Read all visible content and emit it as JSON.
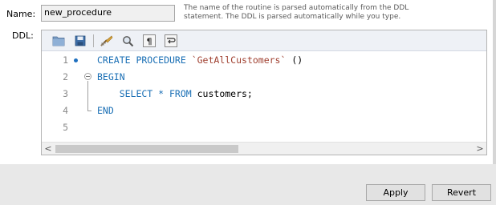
{
  "form": {
    "name_label": "Name:",
    "name_value": "new_procedure",
    "help_line1": "The name of the routine is parsed automatically from the DDL",
    "help_line2": "statement. The DDL is parsed automatically while you type.",
    "ddl_label": "DDL:"
  },
  "toolbar": {
    "buttons": [
      "folder-icon",
      "save-icon",
      "beautify-icon",
      "find-icon",
      "show-invisibles-icon",
      "word-wrap-icon"
    ]
  },
  "editor": {
    "lines": [
      {
        "num": "1",
        "parts": [
          "CREATE PROCEDURE ",
          "`GetAllCustomers`",
          " ()"
        ]
      },
      {
        "num": "2",
        "parts": [
          "BEGIN"
        ]
      },
      {
        "num": "3",
        "parts": [
          "    SELECT * FROM ",
          "customers;"
        ]
      },
      {
        "num": "4",
        "parts": [
          "END"
        ]
      },
      {
        "num": "5",
        "parts": [
          ""
        ]
      }
    ],
    "scroll_left": "<",
    "scroll_right": ">"
  },
  "colors": {
    "keyword": "#1a6fb5",
    "identifier": "#a04030",
    "marker": "#1e6fbf"
  },
  "actions": {
    "apply": "Apply",
    "revert": "Revert"
  }
}
